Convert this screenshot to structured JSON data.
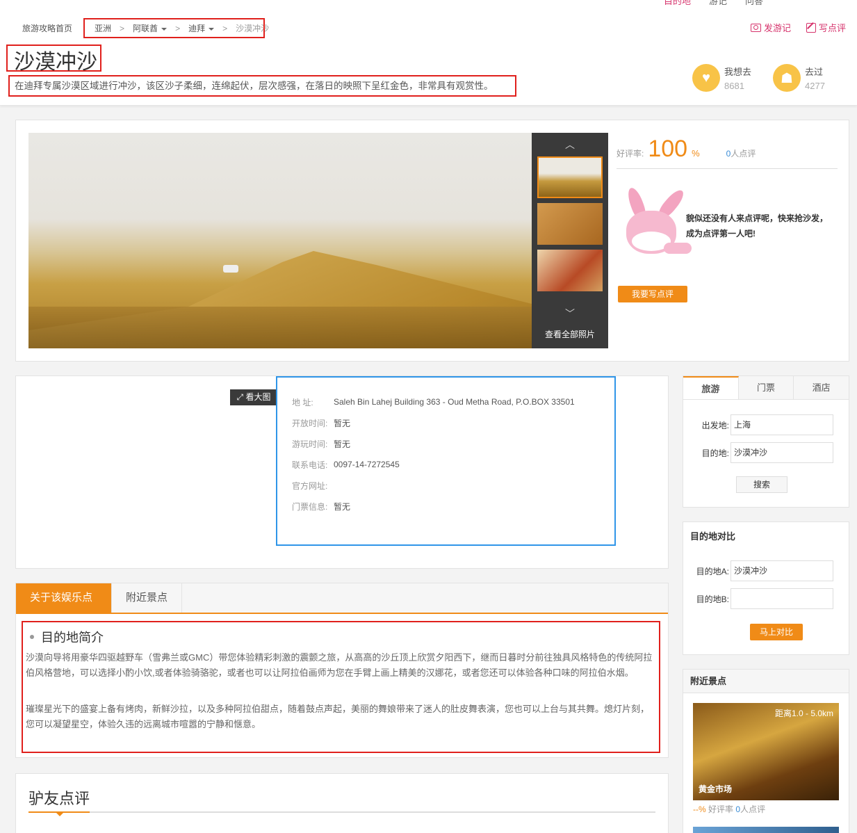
{
  "topnav": [
    "目的地",
    "游记",
    "问答"
  ],
  "breadcrumb": {
    "home": "旅游攻略首页",
    "items": [
      "亚洲",
      "阿联酋",
      "迪拜"
    ],
    "current": "沙漠冲沙",
    "sep": ">"
  },
  "actions": {
    "write_travel": "发游记",
    "write_review": "写点评"
  },
  "title": "沙漠冲沙",
  "description": "在迪拜专属沙漠区域进行冲沙，该区沙子柔细，连绵起伏，层次感强，在落日的映照下呈红金色，非常具有观赏性。",
  "stats": {
    "want": {
      "label": "我想去",
      "count": "8681"
    },
    "been": {
      "label": "去过",
      "count": "4277"
    }
  },
  "gallery": {
    "view_all": "查看全部照片"
  },
  "rating": {
    "label": "好评率:",
    "value": "100",
    "unit": "%",
    "count_num": "0",
    "count_label": "人点评",
    "empty_text": "貌似还没有人来点评呢，快来抢沙发，成为点评第一人吧!",
    "button": "我要写点评"
  },
  "map": {
    "view_big": "看大图"
  },
  "info": [
    {
      "k": "地  址:",
      "v": "Saleh Bin Lahej Building 363 - Oud Metha Road, P.O.BOX 33501"
    },
    {
      "k": "开放时间:",
      "v": "暂无"
    },
    {
      "k": "游玩时间:",
      "v": "暂无"
    },
    {
      "k": "联系电话:",
      "v": "0097-14-7272545"
    },
    {
      "k": "官方网址:",
      "v": ""
    },
    {
      "k": "门票信息:",
      "v": "暂无"
    }
  ],
  "about": {
    "tabs": [
      "关于该娱乐点",
      "附近景点"
    ],
    "heading": "目的地简介",
    "p1": "沙漠向导将用豪华四驱越野车（雪弗兰或GMC）带您体验精彩刺激的震颤之旅，从高高的沙丘顶上欣赏夕阳西下，继而日暮时分前往独具风格特色的传统阿拉伯风格营地，可以选择小酌小饮,或者体验骑骆驼，或者也可以让阿拉伯画师为您在手臂上画上精美的汉娜花，或者您还可以体验各种口味的阿拉伯水烟。",
    "p2": "璀璨星光下的盛宴上备有烤肉，新鲜沙拉，以及多种阿拉伯甜点，随着鼓点声起，美丽的舞娘带来了迷人的肚皮舞表演，您也可以上台与其共舞。熄灯片刻，您可以凝望星空，体验久违的远离城市喧嚣的宁静和惬意。"
  },
  "comments": {
    "title": "驴友点评"
  },
  "search": {
    "tabs": [
      "旅游",
      "门票",
      "酒店"
    ],
    "from_label": "出发地:",
    "from_value": "上海",
    "to_label": "目的地:",
    "to_value": "沙漠冲沙",
    "button": "搜索"
  },
  "compare": {
    "title": "目的地对比",
    "a_label": "目的地A:",
    "a_value": "沙漠冲沙",
    "b_label": "目的地B:",
    "b_value": "",
    "button": "马上对比"
  },
  "nearby": {
    "title": "附近景点",
    "distance": "距离1.0 - 5.0km",
    "name": "黄金市场",
    "rate": "--%",
    "rate_label": "好评率",
    "count": "0",
    "count_label": "人点评"
  }
}
